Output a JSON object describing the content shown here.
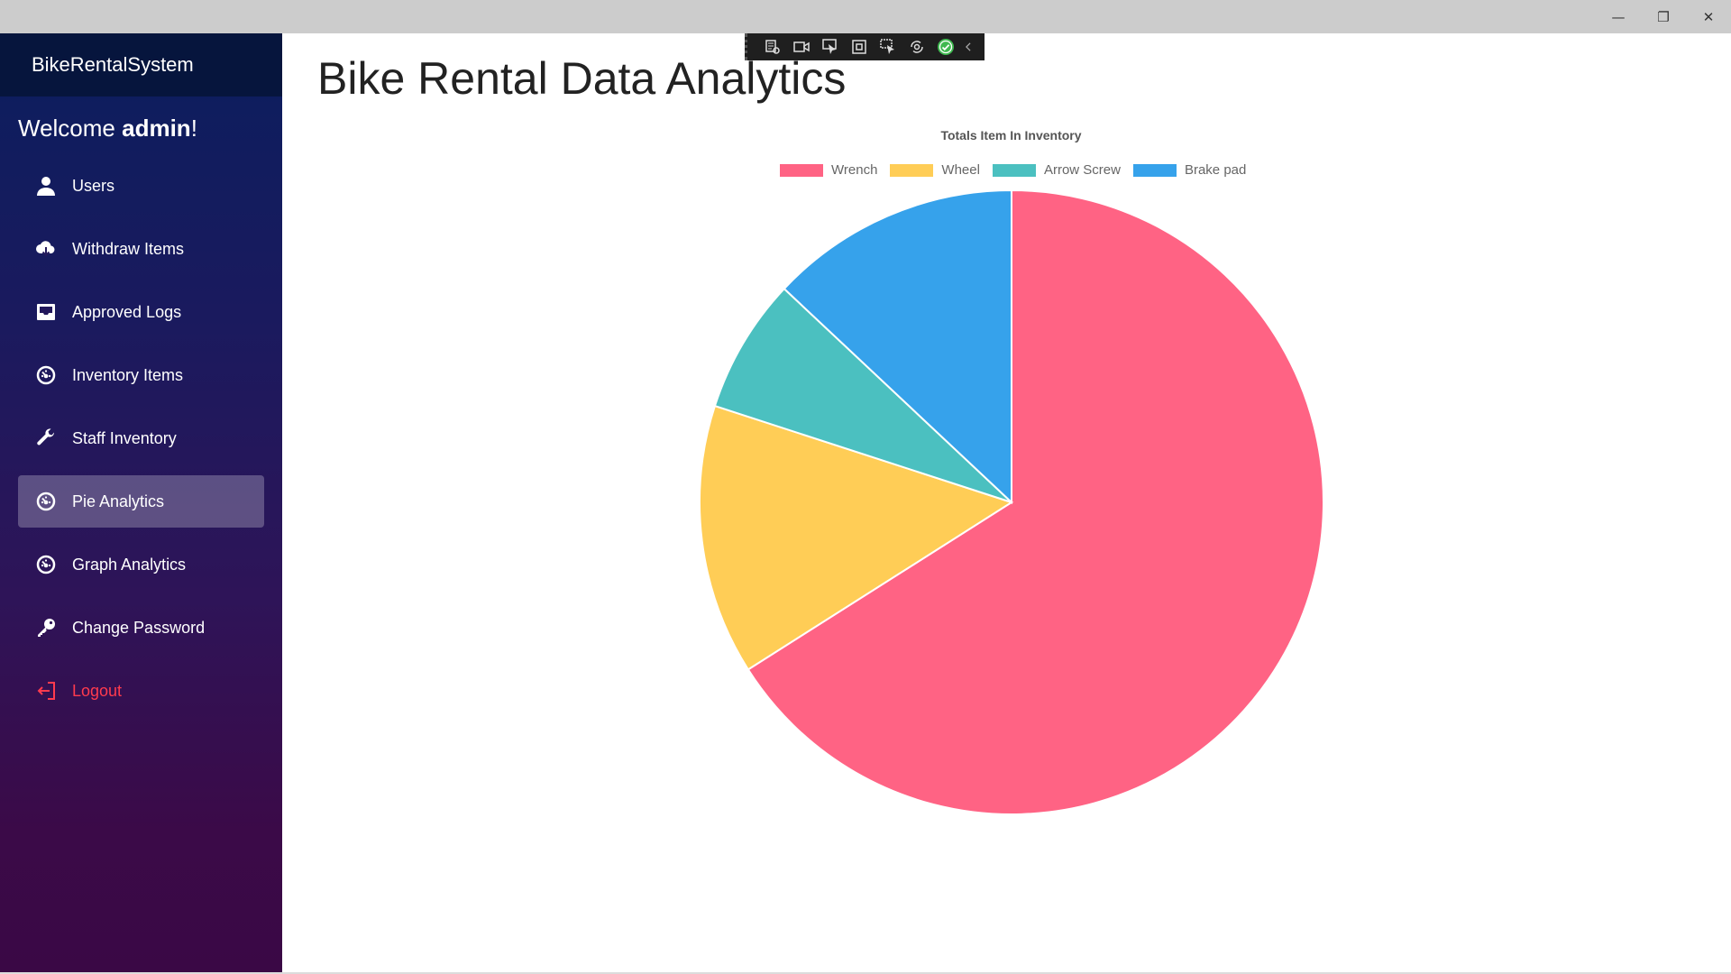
{
  "app": {
    "brand": "BikeRentalSystem",
    "welcome_prefix": "Welcome ",
    "welcome_user": "admin",
    "welcome_suffix": "!"
  },
  "sidebar": {
    "items": [
      {
        "label": "Users",
        "icon": "user-icon",
        "active": false
      },
      {
        "label": "Withdraw Items",
        "icon": "cloud-download-icon",
        "active": false
      },
      {
        "label": "Approved Logs",
        "icon": "inbox-icon",
        "active": false
      },
      {
        "label": "Inventory Items",
        "icon": "dashboard-gauge-icon",
        "active": false
      },
      {
        "label": "Staff Inventory",
        "icon": "wrench-icon",
        "active": false
      },
      {
        "label": "Pie Analytics",
        "icon": "dashboard-gauge-icon",
        "active": true
      },
      {
        "label": "Graph Analytics",
        "icon": "dashboard-gauge-icon",
        "active": false
      },
      {
        "label": "Change Password",
        "icon": "key-icon",
        "active": false
      },
      {
        "label": "Logout",
        "icon": "logout-icon",
        "active": false
      }
    ]
  },
  "main": {
    "title": "Bike Rental Data Analytics"
  },
  "colors": {
    "wrench": "#ff6384",
    "wheel": "#ffcd56",
    "arrow_screw": "#4bc0c0",
    "brake_pad": "#36a2eb",
    "logout": "#ff3b4e"
  },
  "chart_data": {
    "type": "pie",
    "title": "Totals Item In Inventory",
    "categories": [
      "Wrench",
      "Wheel",
      "Arrow Screw",
      "Brake pad"
    ],
    "values": [
      66,
      14,
      7,
      13
    ],
    "colors": [
      "#ff6384",
      "#ffcd56",
      "#4bc0c0",
      "#36a2eb"
    ],
    "legend_position": "top"
  }
}
